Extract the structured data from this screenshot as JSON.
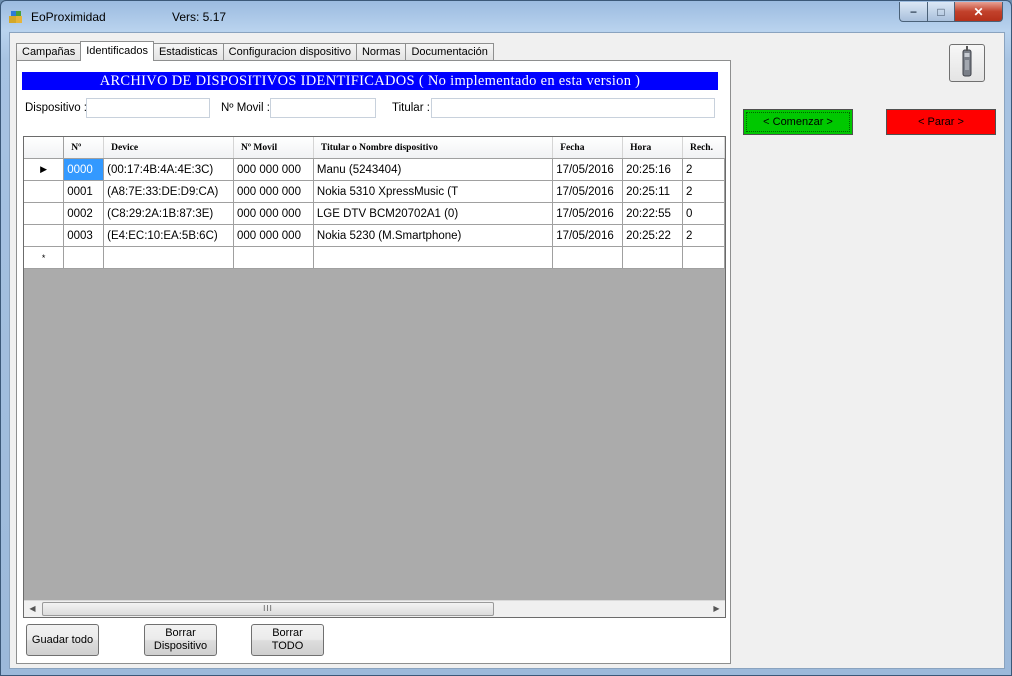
{
  "window": {
    "title": "EoProximidad",
    "version": "Vers: 5.17",
    "controls": {
      "minimize": "−",
      "maximize": "□",
      "close": "✕"
    }
  },
  "tabs": [
    {
      "label": "Campañas"
    },
    {
      "label": "Identificados",
      "active": true
    },
    {
      "label": "Estadisticas"
    },
    {
      "label": "Configuracion dispositivo"
    },
    {
      "label": "Normas"
    },
    {
      "label": "Documentación"
    }
  ],
  "banner": {
    "text": "ARCHIVO DE DISPOSITIVOS IDENTIFICADOS  ( No implementado en esta version )",
    "color": "#0000ff"
  },
  "filters": {
    "dispositivo": {
      "label": "Dispositivo :",
      "value": ""
    },
    "movil": {
      "label": "Nº Movil :",
      "value": ""
    },
    "titular": {
      "label": "Titular :",
      "value": ""
    }
  },
  "grid": {
    "columns": [
      "Nº",
      "Device",
      "Nº Movil",
      "Titular o Nombre dispositivo",
      "Fecha",
      "Hora",
      "Rech."
    ],
    "rows": [
      {
        "n": "0000",
        "device": "(00:17:4B:4A:4E:3C)",
        "movil": "000 000 000",
        "titular": "Manu (5243404)",
        "fecha": "17/05/2016",
        "hora": "20:25:16",
        "rech": "2",
        "current": true
      },
      {
        "n": "0001",
        "device": "(A8:7E:33:DE:D9:CA)",
        "movil": "000 000 000",
        "titular": "Nokia 5310 XpressMusic (T",
        "fecha": "17/05/2016",
        "hora": "20:25:11",
        "rech": "2"
      },
      {
        "n": "0002",
        "device": "(C8:29:2A:1B:87:3E)",
        "movil": "000 000 000",
        "titular": "LGE DTV BCM20702A1 (0)",
        "fecha": "17/05/2016",
        "hora": "20:22:55",
        "rech": "0"
      },
      {
        "n": "0003",
        "device": "(E4:EC:10:EA:5B:6C)",
        "movil": "000 000 000",
        "titular": "Nokia 5230 (M.Smartphone)",
        "fecha": "17/05/2016",
        "hora": "20:25:22",
        "rech": "2"
      }
    ],
    "current_row_glyph": "▶",
    "new_row_glyph": "*",
    "scroll_left": "◀",
    "scroll_right": "▶",
    "scroll_grip": "III"
  },
  "buttons": {
    "guardar": "Guadar todo",
    "borrar_dispositivo": [
      "Borrar",
      "Dispositivo"
    ],
    "borrar_todo": [
      "Borrar",
      "TODO"
    ],
    "comenzar": "< Comenzar >",
    "parar": "< Parar >"
  },
  "colors": {
    "comenzar": "#00c800",
    "parar": "#ff0000",
    "selection": "#3399ff"
  },
  "icons": {
    "app": "app-icon",
    "device": "bluetooth-device-icon"
  }
}
